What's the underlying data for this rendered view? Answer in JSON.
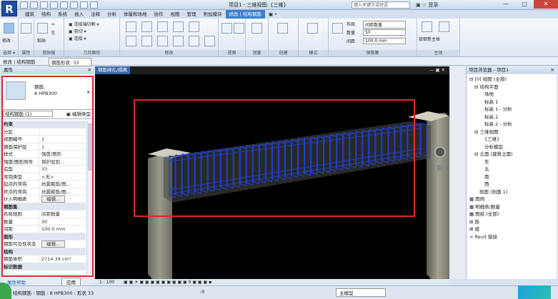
{
  "app": {
    "logo": "R",
    "title": "项目1 - 三维视图: {三维}",
    "search_placeholder": "键入关键字或短语",
    "login": "登录",
    "win_min": "—",
    "win_max": "□",
    "win_close": "✕"
  },
  "ribbon_tabs": [
    "建筑",
    "结构",
    "系统",
    "插入",
    "注释",
    "分析",
    "体量和场地",
    "协作",
    "视图",
    "管理",
    "附加模块",
    "修改 | 结构钢筋",
    "▣ •"
  ],
  "ribbon_groups": {
    "select": "选择 ▾",
    "properties": "属性",
    "clipboard": "剪贴板",
    "geometry": "几何图形",
    "modify": "修改",
    "view": "视图",
    "measure": "测量",
    "create": "创建",
    "mode": "模式",
    "rebar_set": "钢筋集",
    "host": "主体"
  },
  "ribbon_small": {
    "modify": "修改",
    "paste": "粘贴",
    "connect": "▣ 连接端切割 ▾",
    "cut": "▣ 剪切 ▾",
    "join": "▣ 连接 ▾",
    "layout": "布局",
    "layout_value": "间距数量",
    "count": "数量",
    "count_value": "50",
    "spacing": "间距",
    "spacing_value": "100.0 mm",
    "edit_constraints": "编辑约束",
    "edit_sketch": "编辑草图",
    "pick_new": "拾取新主体",
    "remove": "删除",
    "presentation": "表示",
    "edit_host": "编辑主体",
    "picked": "选择 • 钢筋集 ▾"
  },
  "optbar": {
    "label": "修改 | 结构钢筋",
    "view_scale": "钢筋形状: 33"
  },
  "properties": {
    "title": "属性",
    "close": "✕",
    "type_family": "钢筋",
    "type_name": "8 HPB300",
    "selector": "结构钢筋 (1)",
    "edit_type": "编辑类型",
    "rows": [
      {
        "k": "约束",
        "v": "",
        "cat": true
      },
      {
        "k": "分区",
        "v": ""
      },
      {
        "k": "视图编号",
        "v": "1"
      },
      {
        "k": "钢筋保护层",
        "v": "1"
      },
      {
        "k": "样式",
        "v": "强度/图形"
      },
      {
        "k": "强度/图形附件",
        "v": "保护层到..."
      },
      {
        "k": "造型",
        "v": "33"
      },
      {
        "k": "弯钩类型",
        "v": "<无>"
      },
      {
        "k": "起点的弯钩",
        "v": "抗震箍筋/图..."
      },
      {
        "k": "终点的弯钩",
        "v": "抗震箍筋/图..."
      },
      {
        "k": "计入明细表",
        "v": "编辑...",
        "btn": true
      },
      {
        "k": "钢筋集",
        "v": "",
        "cat": true
      },
      {
        "k": "布局规则",
        "v": "间距数量"
      },
      {
        "k": "数量",
        "v": "30"
      },
      {
        "k": "间距",
        "v": "100.0 mm"
      },
      {
        "k": "图形",
        "v": "",
        "cat": true
      },
      {
        "k": "钢筋可见性状态",
        "v": "编辑...",
        "btn": true
      },
      {
        "k": "结构",
        "v": "",
        "cat": true
      },
      {
        "k": "钢筋体积",
        "v": "2714.34 cm³"
      },
      {
        "k": "标识数据",
        "v": "",
        "cat": true
      }
    ],
    "help": "属性帮助",
    "apply": "应用"
  },
  "viewport": {
    "tab": "钢筋绑扎/隔离",
    "controls": "— ▣ ✕",
    "scale": "1 : 100",
    "bottom_tools": "▣ ▣ ☀ ▣ ▣ ▣ ▣ ▣ ▣ ▣ ▣ ▣ 9 ▣ ▣ ▣ ▪"
  },
  "browser": {
    "title": "项目浏览器 - 项目1",
    "close": "✕",
    "tree": [
      {
        "t": "⊟ [0] 视图 (全部)",
        "i": 0
      },
      {
        "t": "⊟ 结构平面",
        "i": 1
      },
      {
        "t": "场地",
        "i": 3
      },
      {
        "t": "标高 1",
        "i": 3
      },
      {
        "t": "标高 1 - 分析",
        "i": 3
      },
      {
        "t": "标高 2",
        "i": 3
      },
      {
        "t": "标高 2 - 分析",
        "i": 3
      },
      {
        "t": "⊟ 三维视图",
        "i": 1
      },
      {
        "t": "{三维}",
        "i": 3
      },
      {
        "t": "分析模型",
        "i": 3
      },
      {
        "t": "⊟ 立面 (建筑立面)",
        "i": 1
      },
      {
        "t": "东",
        "i": 3
      },
      {
        "t": "北",
        "i": 3
      },
      {
        "t": "南",
        "i": 3
      },
      {
        "t": "西",
        "i": 3
      },
      {
        "t": "剖面 (剖面 1)",
        "i": 2
      },
      {
        "t": "▦ 图例",
        "i": 0
      },
      {
        "t": "▦ 明细表/数量",
        "i": 0
      },
      {
        "t": "▦ 图纸 (全部)",
        "i": 0
      },
      {
        "t": "⊞ 族",
        "i": 0
      },
      {
        "t": "⊞ 组",
        "i": 0
      },
      {
        "t": "∞ Revit 链接",
        "i": 0
      }
    ]
  },
  "status": {
    "text": "结构钢筋 : 钢筋 : 8 HPB300 : 形状 33",
    "model": "主模型",
    "zero": ":0"
  },
  "colors": {
    "highlight_box": "#e0262a",
    "rebar": "#1f3fd4",
    "tab_active": "#3a7fca"
  }
}
